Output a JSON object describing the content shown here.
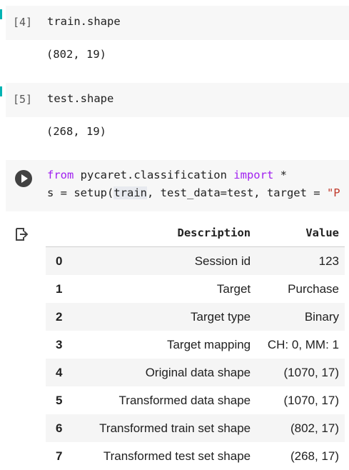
{
  "cells": [
    {
      "prompt": "[4]",
      "code": "train.shape",
      "output": "(802, 19)"
    },
    {
      "prompt": "[5]",
      "code": "test.shape",
      "output": "(268, 19)"
    }
  ],
  "cell3": {
    "line1": {
      "kw1": "from",
      "mid": " pycaret.classification ",
      "kw2": "import",
      "end": " *"
    },
    "line2": {
      "pre": "s = setup(",
      "hl": "train",
      "post": ", test_data=test, target = ",
      "str": "\"P"
    }
  },
  "table": {
    "headers": [
      "",
      "Description",
      "Value"
    ],
    "rows": [
      {
        "idx": "0",
        "desc": "Session id",
        "value": "123"
      },
      {
        "idx": "1",
        "desc": "Target",
        "value": "Purchase"
      },
      {
        "idx": "2",
        "desc": "Target type",
        "value": "Binary"
      },
      {
        "idx": "3",
        "desc": "Target mapping",
        "value": "CH: 0, MM: 1"
      },
      {
        "idx": "4",
        "desc": "Original data shape",
        "value": "(1070, 17)"
      },
      {
        "idx": "5",
        "desc": "Transformed data shape",
        "value": "(1070, 17)"
      },
      {
        "idx": "6",
        "desc": "Transformed train set shape",
        "value": "(802, 17)"
      },
      {
        "idx": "7",
        "desc": "Transformed test set shape",
        "value": "(268, 17)"
      }
    ]
  },
  "colors": {
    "input_bg": "#f7f7f7",
    "keyword": "#a020f0",
    "string": "#c0392b",
    "run_marker": "#00b3b3"
  }
}
